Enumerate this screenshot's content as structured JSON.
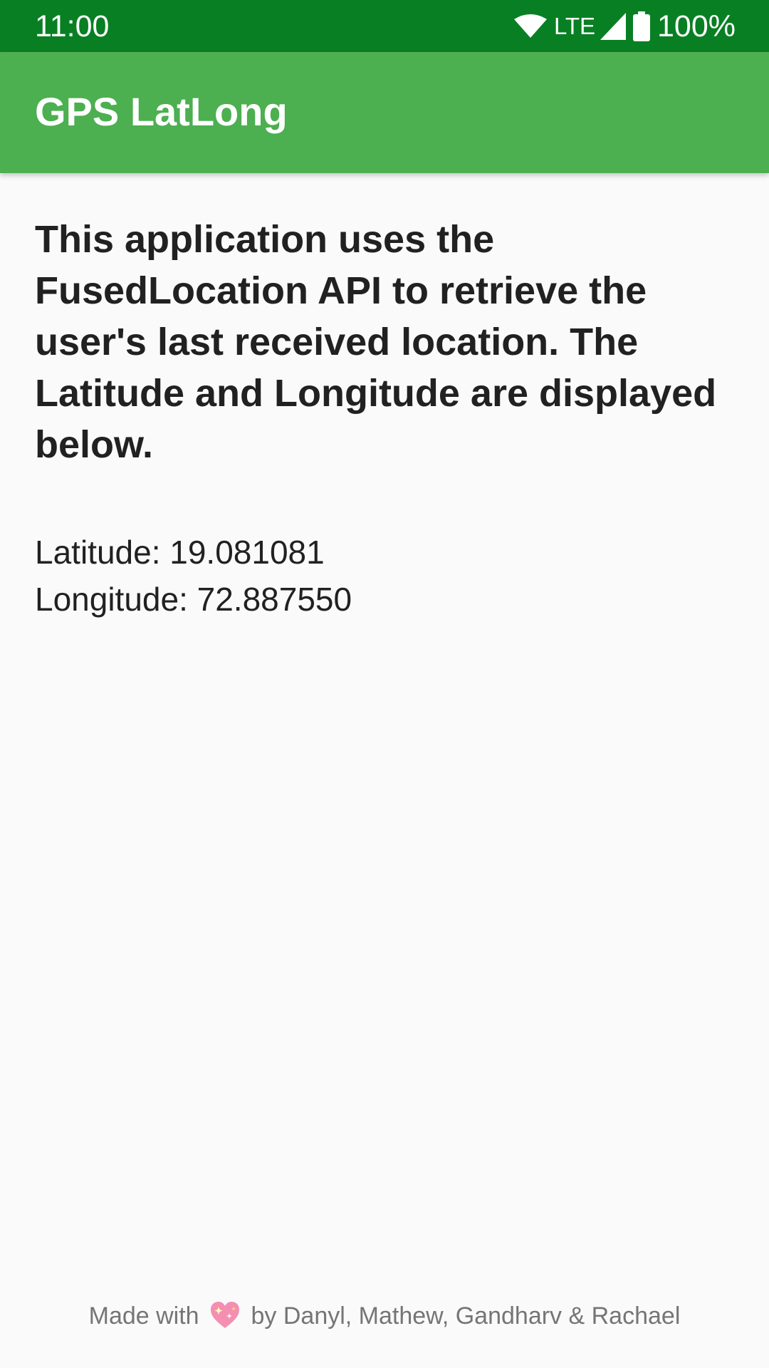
{
  "status_bar": {
    "time": "11:00",
    "network_label": "LTE",
    "battery_percent": "100%",
    "icons": [
      "wifi-icon",
      "signal-icon",
      "battery-icon"
    ],
    "background_color": "#087f23"
  },
  "app_bar": {
    "title": "GPS LatLong",
    "background_color": "#4caf50"
  },
  "main": {
    "description": "This application uses the FusedLocation API to retrieve the user's last received location. The Latitude and Longitude are displayed below.",
    "latitude_label": "Latitude: 19.081081",
    "longitude_label": "Longitude: 72.887550"
  },
  "footer": {
    "prefix": "Made with",
    "icon": "heart-icon",
    "suffix": "by Danyl, Mathew, Gandharv & Rachael"
  }
}
